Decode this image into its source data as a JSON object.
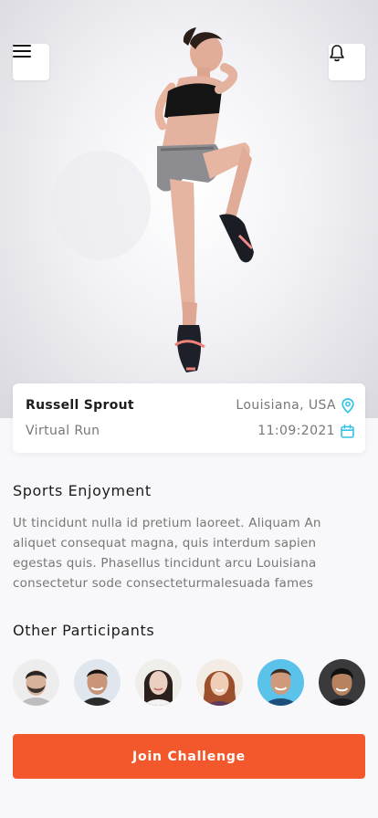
{
  "header": {
    "menu_icon": "hamburger-menu-icon",
    "notification_icon": "bell-icon"
  },
  "event": {
    "organizer": "Russell Sprout",
    "location": "Louisiana, USA",
    "type": "Virtual Run",
    "date": "11:09:2021",
    "location_icon": "map-pin-icon",
    "date_icon": "calendar-icon",
    "icon_color": "#33c3e8"
  },
  "about": {
    "title": "Sports Enjoyment",
    "text": "Ut tincidunt nulla id pretium laoreet. Aliquam An aliquet consequat magna, quis interdum sapien egestas quis. Phasellus tincidunt arcu Louisiana consectetur sode consecteturmalesuada fames"
  },
  "participants": {
    "title": "Other Participants",
    "avatars": [
      {
        "icon": "avatar-man-beard"
      },
      {
        "icon": "avatar-man-smiling"
      },
      {
        "icon": "avatar-woman-brunette"
      },
      {
        "icon": "avatar-woman-redhead"
      },
      {
        "icon": "avatar-man-blue-background"
      },
      {
        "icon": "avatar-man-dark-hair"
      }
    ]
  },
  "cta": {
    "label": "Join Challenge",
    "color": "#f3582c"
  }
}
